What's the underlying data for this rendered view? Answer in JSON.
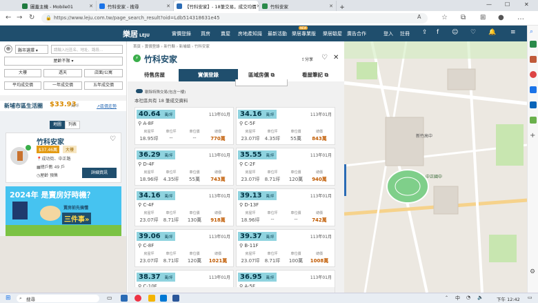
{
  "browser": {
    "tabs": [
      {
        "label": "圖蓋主機 - Mobile01",
        "color": "#1f7a3e"
      },
      {
        "label": "竹科安家 - 搜尋",
        "color": "#1a73e8"
      },
      {
        "label": "【竹科安家】- 18筆交易，成交均價",
        "color": "#2a6bb5"
      },
      {
        "label": "竹科安家",
        "color": "#2a8a4a"
      }
    ],
    "url": "https://www.leju.com.tw/page_search_result?oid=Ldb514318631e45"
  },
  "site": {
    "logo": "樂居",
    "logo_sub": "LEJU",
    "nav": [
      "實價登錄",
      "買房",
      "賣屋",
      "房地產知識",
      "最新活動",
      "樂居專業版",
      "樂居驗屋",
      "廣告合作"
    ],
    "new_badge": "NEW",
    "login": "登入",
    "register": "註冊"
  },
  "left": {
    "city_select": "縣市選擇",
    "search_placeholder": "請輸入社區名、地址、路段...",
    "house_type": "屋齡不限",
    "filters": [
      "大樓",
      "透天",
      "店面/公寓",
      "平均成交價",
      "一年成交價",
      "五年成交價"
    ],
    "district": "新埔市區生活圈",
    "district_price": "$33.93",
    "district_unit": "萬/坪",
    "trend_link": "區價走勢",
    "view_tabs": [
      "地圖",
      "列表"
    ],
    "listing": {
      "title": "竹科安家",
      "price": "$37.46",
      "price_unit": "萬",
      "type": "大樓",
      "addr": "成功街、中正路",
      "units": "總戶數 49 戶",
      "age": "屋齡 預售",
      "detail_btn": "詳細資訊"
    },
    "banner_line1": "2024年 是賣房好時機？",
    "banner_line2": "賣房前先搞懂",
    "banner_line3": "三件事»"
  },
  "center": {
    "breadcrumb": [
      "首頁",
      "實價登錄",
      "新竹縣",
      "新埔鎮",
      "竹科安家"
    ],
    "title": "竹科安家",
    "share": "分享",
    "tabs": [
      "待售房屋",
      "實價登錄",
      "區域房價",
      "看屋筆記"
    ],
    "checkbox_label": "剔除特殊交易(包含一樓)",
    "summary": "本社區共有 18 筆成交資料",
    "col_labels": [
      "房屋坪",
      "車位坪",
      "車位價",
      "總價"
    ],
    "cards": [
      {
        "price": "40.64",
        "unit": "萬/坪",
        "date": "113年01月",
        "floor": "A-8F",
        "vals": [
          "18.95坪",
          "--",
          "--",
          "770萬"
        ]
      },
      {
        "price": "34.16",
        "unit": "萬/坪",
        "date": "113年01月",
        "floor": "C-5F",
        "vals": [
          "23.07坪",
          "4.35坪",
          "55萬",
          "843萬"
        ]
      },
      {
        "price": "36.29",
        "unit": "萬/坪",
        "date": "113年01月",
        "floor": "D-4F",
        "vals": [
          "18.96坪",
          "4.35坪",
          "55萬",
          "743萬"
        ]
      },
      {
        "price": "35.55",
        "unit": "萬/坪",
        "date": "113年01月",
        "floor": "C-2F",
        "vals": [
          "23.07坪",
          "8.71坪",
          "120萬",
          "940萬"
        ]
      },
      {
        "price": "34.16",
        "unit": "萬/坪",
        "date": "113年01月",
        "floor": "C-4F",
        "vals": [
          "23.07坪",
          "8.71坪",
          "130萬",
          "918萬"
        ]
      },
      {
        "price": "39.13",
        "unit": "萬/坪",
        "date": "113年01月",
        "floor": "D-13F",
        "vals": [
          "18.96坪",
          "--",
          "--",
          "742萬"
        ]
      },
      {
        "price": "39.06",
        "unit": "萬/坪",
        "date": "113年01月",
        "floor": "C-8F",
        "vals": [
          "23.07坪",
          "8.71坪",
          "120萬",
          "1021萬"
        ]
      },
      {
        "price": "39.37",
        "unit": "萬/坪",
        "date": "113年01月",
        "floor": "B-11F",
        "vals": [
          "23.07坪",
          "8.71坪",
          "100萬",
          "1008萬"
        ]
      },
      {
        "price": "38.37",
        "unit": "萬/坪",
        "date": "113年01月",
        "floor": "C-10F",
        "vals": [
          "",
          "",
          "",
          ""
        ]
      },
      {
        "price": "36.95",
        "unit": "萬/坪",
        "date": "113年01月",
        "floor": "A-5F",
        "vals": [
          "",
          "",
          "",
          ""
        ]
      }
    ]
  },
  "map": {
    "school_label": "中正國中",
    "label2": "新竹高中"
  },
  "taskbar": {
    "search": "搜尋",
    "lang": "中",
    "time": "下午 12:42"
  }
}
